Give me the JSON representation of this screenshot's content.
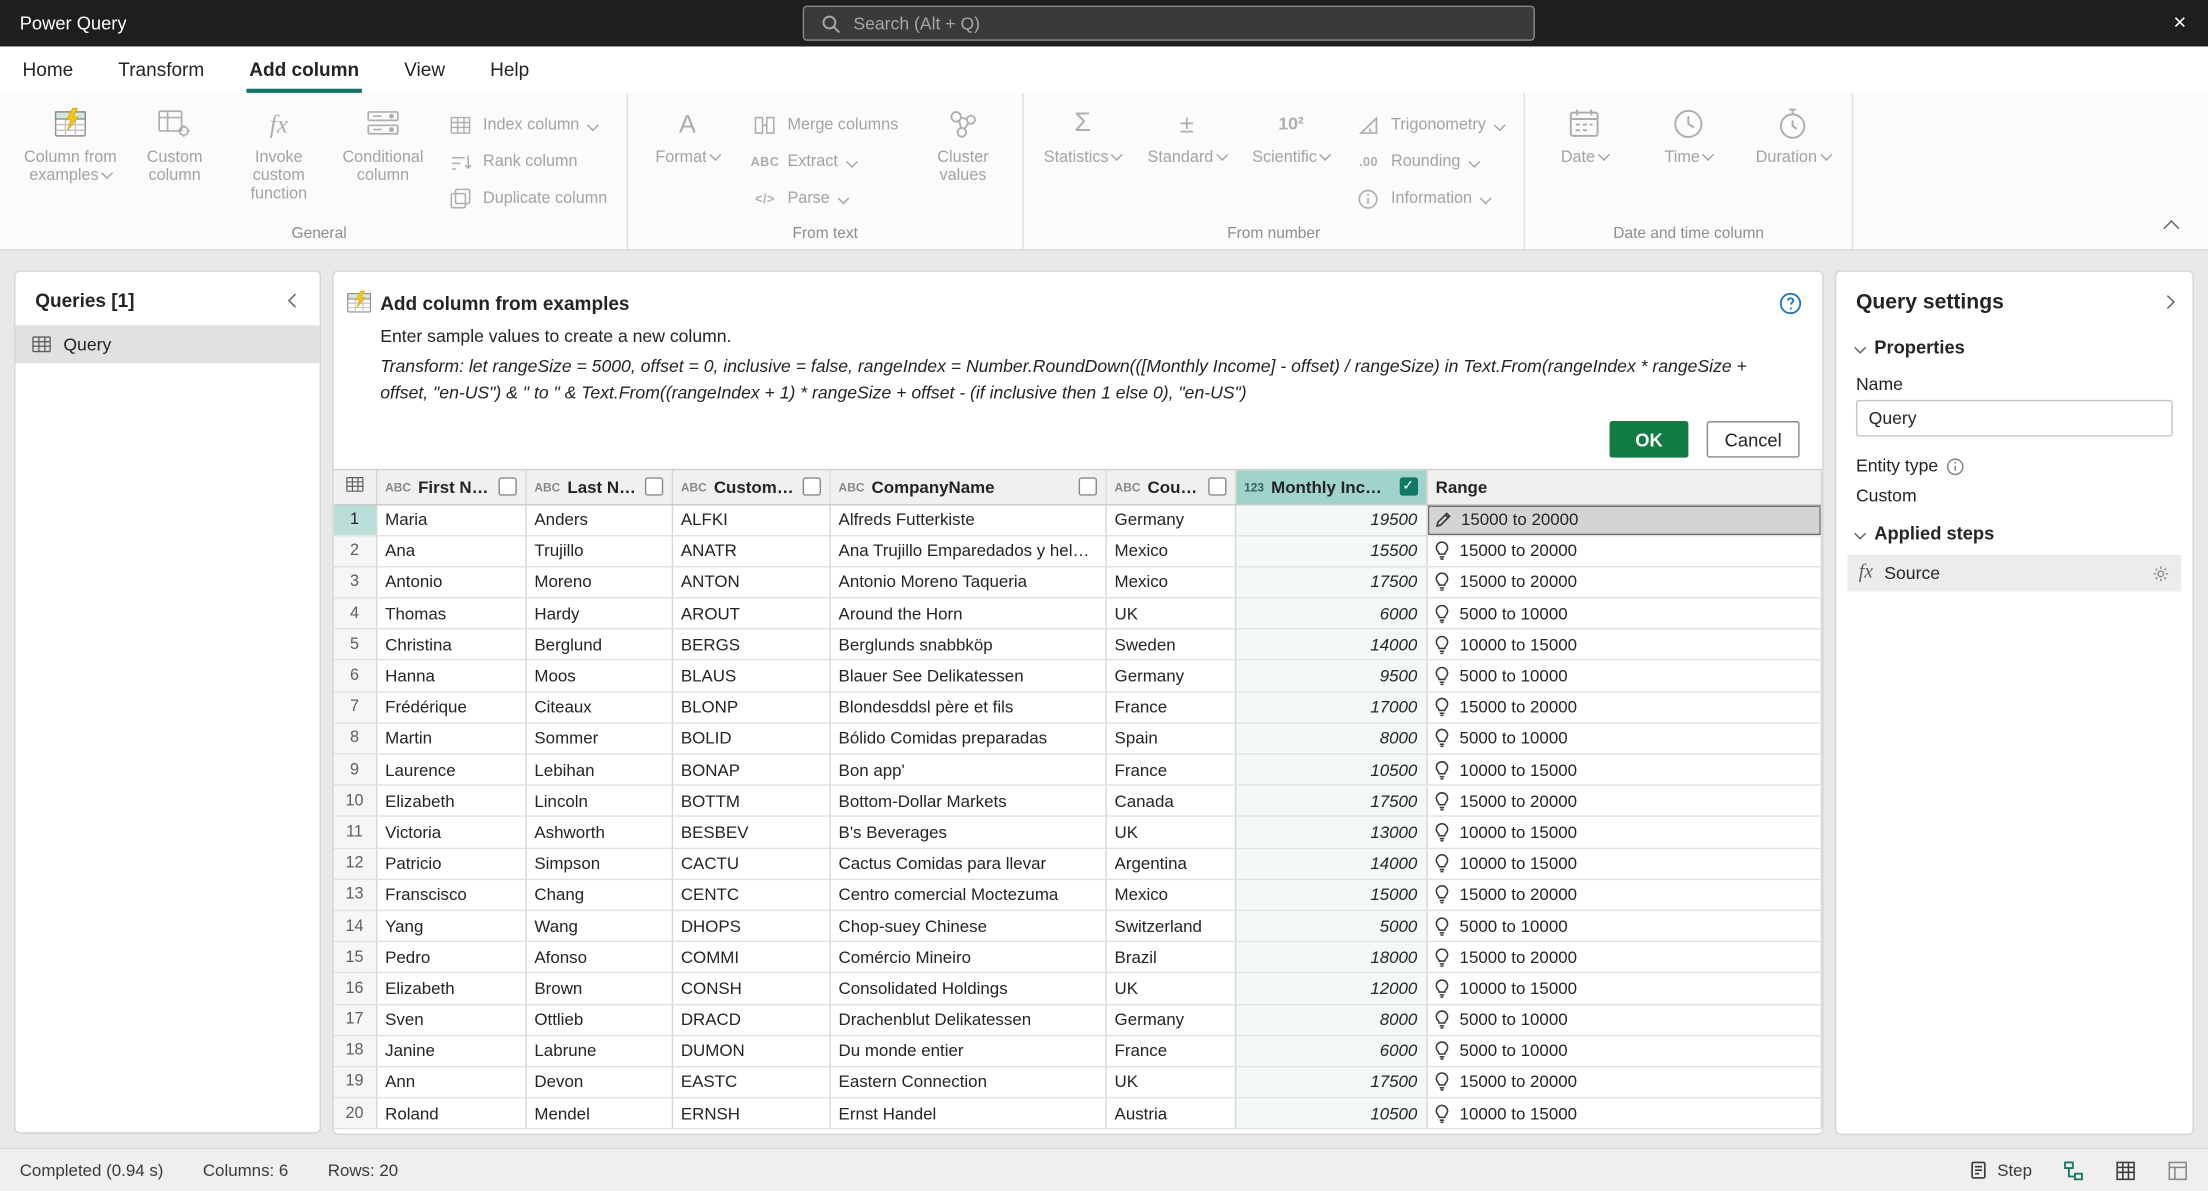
{
  "colors": {
    "accent": "#117865",
    "ok_green": "#107c41",
    "header_selected": "#9fd3cb",
    "row_selected": "#b9dfd8",
    "income_tint": "#f2f9f7",
    "titlebar_bg": "#1f1e1e"
  },
  "titlebar": {
    "app_title": "Power Query",
    "search_placeholder": "Search (Alt + Q)",
    "close_glyph": "×"
  },
  "menu": {
    "tabs": [
      {
        "label": "Home"
      },
      {
        "label": "Transform"
      },
      {
        "label": "Add column",
        "active": true
      },
      {
        "label": "View"
      },
      {
        "label": "Help"
      }
    ]
  },
  "ribbon": {
    "groups": [
      {
        "label": "General",
        "items": [
          {
            "label": "Column from examples",
            "icon": "gridColored26",
            "type": "large",
            "dropdown": true
          },
          {
            "label": "Custom column",
            "icon": "gearGrid",
            "type": "large"
          },
          {
            "label": "Invoke custom function",
            "icon": "fx",
            "type": "large"
          },
          {
            "label": "Conditional column",
            "icon": "condGrid",
            "type": "large"
          },
          {
            "label": "Index column",
            "icon": "grid16",
            "type": "small",
            "dropdown": true
          },
          {
            "label": "Rank column",
            "icon": "rank",
            "type": "small"
          },
          {
            "label": "Duplicate column",
            "icon": "duplicate",
            "type": "small"
          }
        ]
      },
      {
        "label": "From text",
        "items": [
          {
            "label": "Format",
            "icon": "format",
            "type": "large",
            "dropdown": true
          },
          {
            "label": "Merge columns",
            "icon": "merge",
            "type": "small"
          },
          {
            "label": "Extract",
            "icon": "extract",
            "type": "small",
            "dropdown": true
          },
          {
            "label": "Parse",
            "icon": "parse",
            "type": "small",
            "dropdown": true
          },
          {
            "label": "Cluster values",
            "icon": "cluster",
            "type": "large"
          }
        ]
      },
      {
        "label": "From number",
        "items": [
          {
            "label": "Statistics",
            "icon": "stat",
            "type": "large",
            "dropdown": true
          },
          {
            "label": "Standard",
            "icon": "standard",
            "type": "large",
            "dropdown": true
          },
          {
            "label": "Scientific",
            "icon": "sci",
            "type": "large",
            "dropdown": true
          },
          {
            "label": "Trigonometry",
            "icon": "trig",
            "type": "small",
            "dropdown": true
          },
          {
            "label": "Rounding",
            "icon": "round",
            "type": "small",
            "dropdown": true
          },
          {
            "label": "Information",
            "icon": "infoCirc",
            "type": "small",
            "dropdown": true
          }
        ]
      },
      {
        "label": "Date and time column",
        "items": [
          {
            "label": "Date",
            "icon": "calendar",
            "type": "large",
            "dropdown": true
          },
          {
            "label": "Time",
            "icon": "clock",
            "type": "large",
            "dropdown": true
          },
          {
            "label": "Duration",
            "icon": "duration",
            "type": "large",
            "dropdown": true
          }
        ]
      }
    ]
  },
  "queries": {
    "title": "Queries [1]",
    "items": [
      {
        "label": "Query",
        "selected": true
      }
    ]
  },
  "dialog": {
    "title": "Add column from examples",
    "subtitle": "Enter sample values to create a new column.",
    "transform": "Transform: let rangeSize = 5000, offset = 0, inclusive = false, rangeIndex = Number.RoundDown(([Monthly Income] - offset) / rangeSize) in Text.From(rangeIndex * rangeSize + offset, \"en-US\") & \" to \" & Text.From((rangeIndex + 1) * rangeSize + offset - (if inclusive then 1 else 0), \"en-US\")",
    "ok_label": "OK",
    "cancel_label": "Cancel"
  },
  "table": {
    "columns": [
      {
        "key": "first_name",
        "label": "First Name",
        "datatype": "text",
        "checked": false
      },
      {
        "key": "last_name",
        "label": "Last Name",
        "datatype": "text",
        "checked": false
      },
      {
        "key": "customer_id",
        "label": "CustomerID",
        "datatype": "text",
        "checked": false
      },
      {
        "key": "company_name",
        "label": "CompanyName",
        "datatype": "text",
        "checked": false
      },
      {
        "key": "country",
        "label": "Country",
        "datatype": "text",
        "checked": false
      },
      {
        "key": "monthly_income",
        "label": "Monthly Income",
        "datatype": "number",
        "checked": true,
        "selected": true
      },
      {
        "key": "range",
        "label": "Range",
        "datatype": "new"
      }
    ],
    "rows": [
      [
        "Maria",
        "Anders",
        "ALFKI",
        "Alfreds Futterkiste",
        "Germany",
        "19500",
        "15000 to 20000"
      ],
      [
        "Ana",
        "Trujillo",
        "ANATR",
        "Ana Trujillo Emparedados y helados",
        "Mexico",
        "15500",
        "15000 to 20000"
      ],
      [
        "Antonio",
        "Moreno",
        "ANTON",
        "Antonio Moreno Taqueria",
        "Mexico",
        "17500",
        "15000 to 20000"
      ],
      [
        "Thomas",
        "Hardy",
        "AROUT",
        "Around the Horn",
        "UK",
        "6000",
        "5000 to 10000"
      ],
      [
        "Christina",
        "Berglund",
        "BERGS",
        "Berglunds snabbköp",
        "Sweden",
        "14000",
        "10000 to 15000"
      ],
      [
        "Hanna",
        "Moos",
        "BLAUS",
        "Blauer See Delikatessen",
        "Germany",
        "9500",
        "5000 to 10000"
      ],
      [
        "Frédérique",
        "Citeaux",
        "BLONP",
        "Blondesddsl père et fils",
        "France",
        "17000",
        "15000 to 20000"
      ],
      [
        "Martin",
        "Sommer",
        "BOLID",
        "Bólido Comidas preparadas",
        "Spain",
        "8000",
        "5000 to 10000"
      ],
      [
        "Laurence",
        "Lebihan",
        "BONAP",
        "Bon app'",
        "France",
        "10500",
        "10000 to 15000"
      ],
      [
        "Elizabeth",
        "Lincoln",
        "BOTTM",
        "Bottom-Dollar Markets",
        "Canada",
        "17500",
        "15000 to 20000"
      ],
      [
        "Victoria",
        "Ashworth",
        "BESBEV",
        "B's Beverages",
        "UK",
        "13000",
        "10000 to 15000"
      ],
      [
        "Patricio",
        "Simpson",
        "CACTU",
        "Cactus Comidas para llevar",
        "Argentina",
        "14000",
        "10000 to 15000"
      ],
      [
        "Franscisco",
        "Chang",
        "CENTC",
        "Centro comercial Moctezuma",
        "Mexico",
        "15000",
        "15000 to 20000"
      ],
      [
        "Yang",
        "Wang",
        "DHOPS",
        "Chop-suey Chinese",
        "Switzerland",
        "5000",
        "5000 to 10000"
      ],
      [
        "Pedro",
        "Afonso",
        "COMMI",
        "Comércio Mineiro",
        "Brazil",
        "18000",
        "15000 to 20000"
      ],
      [
        "Elizabeth",
        "Brown",
        "CONSH",
        "Consolidated Holdings",
        "UK",
        "12000",
        "10000 to 15000"
      ],
      [
        "Sven",
        "Ottlieb",
        "DRACD",
        "Drachenblut Delikatessen",
        "Germany",
        "8000",
        "5000 to 10000"
      ],
      [
        "Janine",
        "Labrune",
        "DUMON",
        "Du monde entier",
        "France",
        "6000",
        "5000 to 10000"
      ],
      [
        "Ann",
        "Devon",
        "EASTC",
        "Eastern Connection",
        "UK",
        "17500",
        "15000 to 20000"
      ],
      [
        "Roland",
        "Mendel",
        "ERNSH",
        "Ernst Handel",
        "Austria",
        "10500",
        "10000 to 15000"
      ]
    ]
  },
  "settings": {
    "title": "Query settings",
    "properties_label": "Properties",
    "name_label": "Name",
    "name_value": "Query",
    "entity_type_label": "Entity type",
    "entity_type_value": "Custom",
    "applied_steps_label": "Applied steps",
    "steps": [
      {
        "label": "Source"
      }
    ]
  },
  "statusbar": {
    "completed": "Completed (0.94 s)",
    "columns": "Columns: 6",
    "rows": "Rows: 20",
    "step_label": "Step"
  }
}
